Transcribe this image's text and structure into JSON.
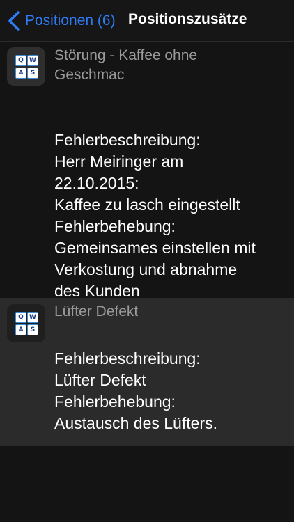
{
  "nav": {
    "back_label": "Positionen (6)",
    "title": "Positionszusätze"
  },
  "icon_keys": [
    "Q",
    "W",
    "A",
    "S"
  ],
  "colors": {
    "accent": "#2f7cf6",
    "background": "#141414",
    "selected_row": "#2b2b2b"
  },
  "items": [
    {
      "title_lines": [
        "Störung - Kaffee ohne",
        "Geschmac"
      ],
      "body_lines": [
        "Fehlerbeschreibung:",
        "Herr Meiringer am",
        "22.10.2015:",
        "Kaffee zu lasch eingestellt",
        "Fehlerbehebung:",
        "Gemeinsames einstellen mit",
        "Verkostung und abnahme",
        "des Kunden"
      ]
    },
    {
      "title_lines": [
        "Lüfter Defekt"
      ],
      "body_lines": [
        "Fehlerbeschreibung:",
        "Lüfter Defekt",
        "Fehlerbehebung:",
        "Austausch des Lüfters."
      ]
    }
  ]
}
